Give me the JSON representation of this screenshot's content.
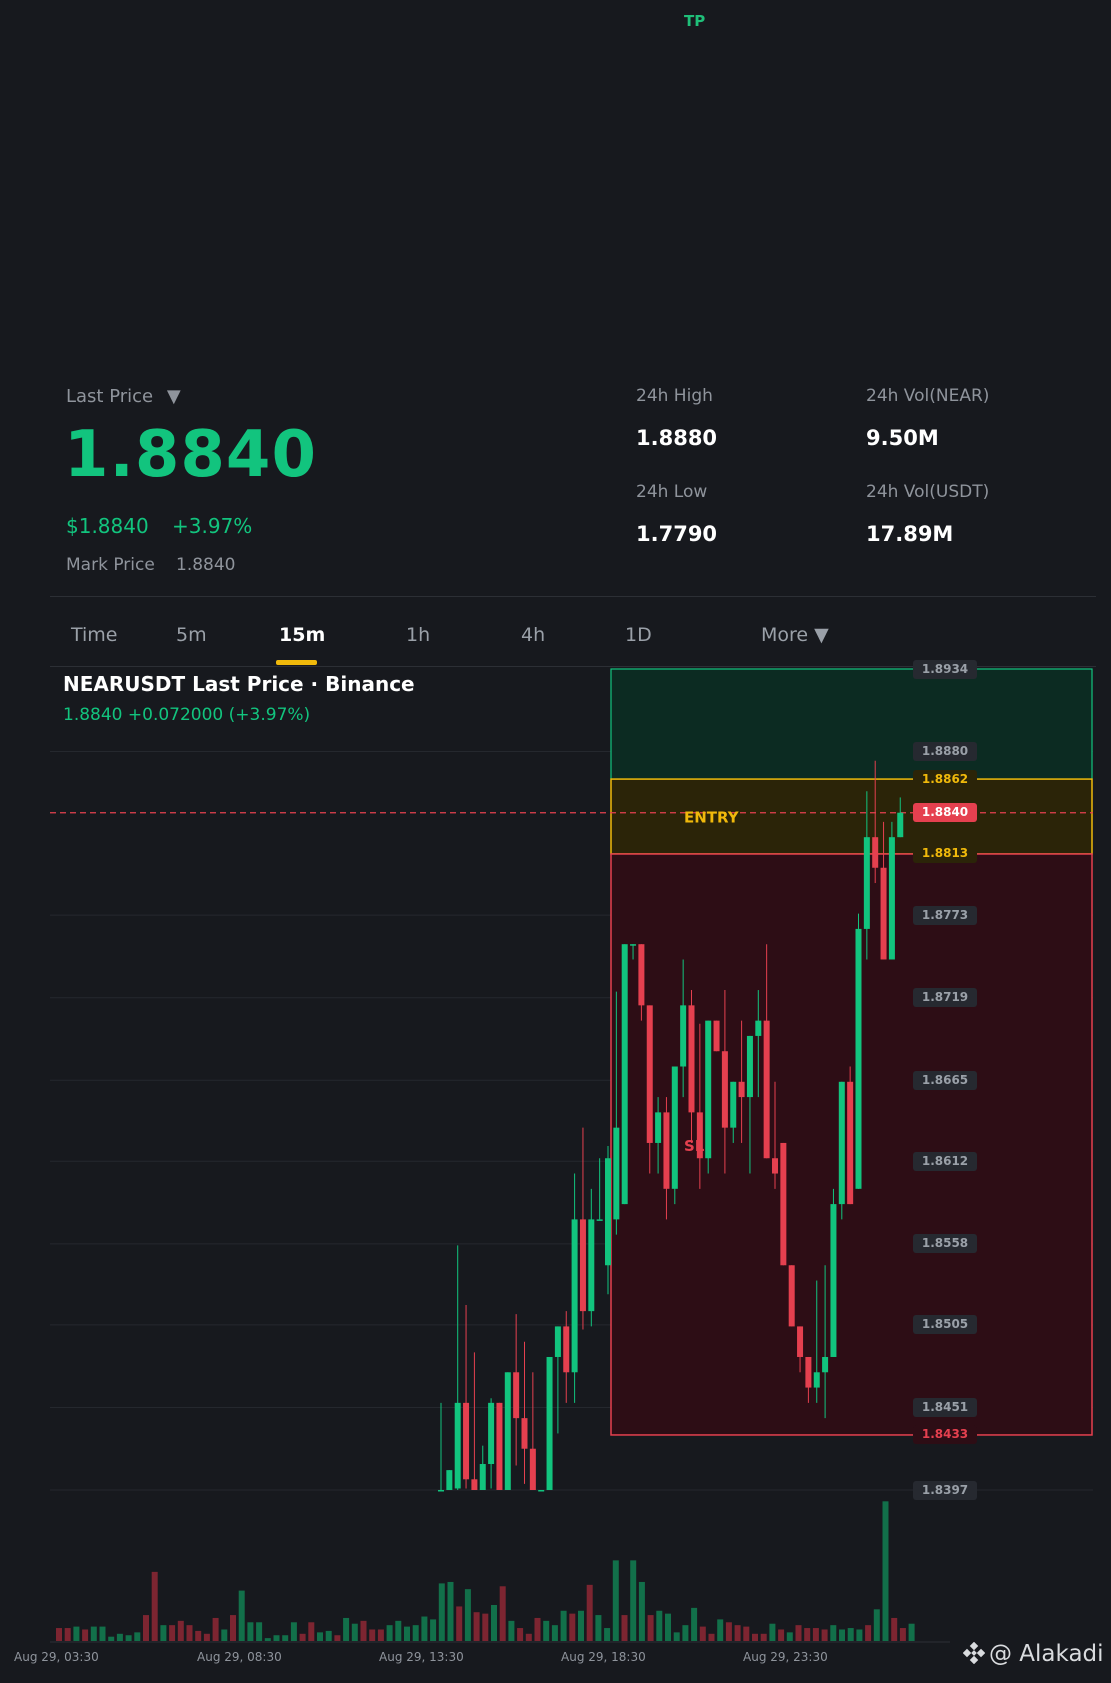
{
  "overlay": {
    "tp_label": "TP",
    "entry_label": "ENTRY",
    "sl_label": "SL"
  },
  "header": {
    "last_price_label": "Last Price",
    "last_price_caret": "▼",
    "last_price": "1.8840",
    "usd_price": "$1.8840",
    "change_pct": "+3.97%",
    "mark_price_label": "Mark Price",
    "mark_price": "1.8840"
  },
  "stats": {
    "high_label": "24h High",
    "high_value": "1.8880",
    "low_label": "24h Low",
    "low_value": "1.7790",
    "vol_base_label": "24h Vol(NEAR)",
    "vol_base_value": "9.50M",
    "vol_quote_label": "24h Vol(USDT)",
    "vol_quote_value": "17.89M"
  },
  "tabs": [
    {
      "label": "Time"
    },
    {
      "label": "5m"
    },
    {
      "label": "15m"
    },
    {
      "label": "1h"
    },
    {
      "label": "4h"
    },
    {
      "label": "1D"
    },
    {
      "label": "More ▼"
    }
  ],
  "active_tab": "15m",
  "chart": {
    "title": "NEARUSDT Last Price · Binance",
    "price_line": "1.8840  +0.072000 (+3.97%)"
  },
  "watermark": "@ Alakadi",
  "colors": {
    "up": "#12c47e",
    "down": "#e5404f",
    "entry": "#f0b90b",
    "tp_zone": "#0c2b22",
    "entry_zone": "#2b2408",
    "sl_zone": "#2d0d15"
  },
  "chart_data": {
    "type": "candlestick",
    "symbol": "NEARUSDT",
    "interval": "15m",
    "x_labels": [
      "Aug 29, 03:30",
      "Aug 29, 08:30",
      "Aug 29, 13:30",
      "Aug 29, 18:30",
      "Aug 29, 23:30"
    ],
    "y_ticks": [
      1.8934,
      1.888,
      1.8773,
      1.8719,
      1.8665,
      1.8612,
      1.8558,
      1.8505,
      1.8451,
      1.8397
    ],
    "levels": {
      "tp": 1.8934,
      "entry_high": 1.8862,
      "entry_low": 1.8813,
      "sl": 1.8433,
      "last": 1.884
    },
    "candles": [
      {
        "o": 1.8392,
        "h": 1.8454,
        "l": 1.8392,
        "c": 1.8397
      },
      {
        "o": 1.8397,
        "h": 1.8404,
        "l": 1.8387,
        "c": 1.841
      },
      {
        "o": 1.8398,
        "h": 1.8557,
        "l": 1.8393,
        "c": 1.8454
      },
      {
        "o": 1.8454,
        "h": 1.8518,
        "l": 1.8398,
        "c": 1.8404
      },
      {
        "o": 1.8404,
        "h": 1.8487,
        "l": 1.8398,
        "c": 1.8393
      },
      {
        "o": 1.8393,
        "h": 1.8426,
        "l": 1.8396,
        "c": 1.8414
      },
      {
        "o": 1.8414,
        "h": 1.8457,
        "l": 1.8398,
        "c": 1.8454
      },
      {
        "o": 1.8454,
        "h": 1.8454,
        "l": 1.8392,
        "c": 1.8393
      },
      {
        "o": 1.8393,
        "h": 1.8474,
        "l": 1.8394,
        "c": 1.8474
      },
      {
        "o": 1.8474,
        "h": 1.8512,
        "l": 1.8413,
        "c": 1.8444
      },
      {
        "o": 1.8444,
        "h": 1.8494,
        "l": 1.8401,
        "c": 1.8424
      },
      {
        "o": 1.8424,
        "h": 1.8474,
        "l": 1.8388,
        "c": 1.8393
      },
      {
        "o": 1.8393,
        "h": 1.8392,
        "l": 1.8392,
        "c": 1.8394
      },
      {
        "o": 1.8394,
        "h": 1.8484,
        "l": 1.8413,
        "c": 1.8484
      },
      {
        "o": 1.8484,
        "h": 1.8504,
        "l": 1.8434,
        "c": 1.8504
      },
      {
        "o": 1.8504,
        "h": 1.8514,
        "l": 1.8454,
        "c": 1.8474
      },
      {
        "o": 1.8474,
        "h": 1.8604,
        "l": 1.8454,
        "c": 1.8574
      },
      {
        "o": 1.8574,
        "h": 1.8634,
        "l": 1.8502,
        "c": 1.8514
      },
      {
        "o": 1.8514,
        "h": 1.8594,
        "l": 1.8504,
        "c": 1.8574
      },
      {
        "o": 1.8574,
        "h": 1.8614,
        "l": 1.8574,
        "c": 1.8574
      },
      {
        "o": 1.8544,
        "h": 1.8622,
        "l": 1.8525,
        "c": 1.8614
      },
      {
        "o": 1.8574,
        "h": 1.8723,
        "l": 1.8564,
        "c": 1.8634
      },
      {
        "o": 1.8584,
        "h": 1.8743,
        "l": 1.8584,
        "c": 1.8754
      },
      {
        "o": 1.8754,
        "h": 1.8744,
        "l": 1.8744,
        "c": 1.8754
      },
      {
        "o": 1.8754,
        "h": 1.8754,
        "l": 1.8704,
        "c": 1.8714
      },
      {
        "o": 1.8714,
        "h": 1.8704,
        "l": 1.8604,
        "c": 1.8624
      },
      {
        "o": 1.8624,
        "h": 1.8654,
        "l": 1.8604,
        "c": 1.8644
      },
      {
        "o": 1.8644,
        "h": 1.8654,
        "l": 1.8574,
        "c": 1.8594
      },
      {
        "o": 1.8594,
        "h": 1.8674,
        "l": 1.8584,
        "c": 1.8674
      },
      {
        "o": 1.8674,
        "h": 1.8744,
        "l": 1.8654,
        "c": 1.8714
      },
      {
        "o": 1.8714,
        "h": 1.8724,
        "l": 1.8624,
        "c": 1.8644
      },
      {
        "o": 1.8644,
        "h": 1.8702,
        "l": 1.8594,
        "c": 1.8614
      },
      {
        "o": 1.8614,
        "h": 1.8704,
        "l": 1.8604,
        "c": 1.8704
      },
      {
        "o": 1.8704,
        "h": 1.8704,
        "l": 1.8684,
        "c": 1.8684
      },
      {
        "o": 1.8684,
        "h": 1.8724,
        "l": 1.8604,
        "c": 1.8634
      },
      {
        "o": 1.8634,
        "h": 1.8664,
        "l": 1.8624,
        "c": 1.8664
      },
      {
        "o": 1.8664,
        "h": 1.8704,
        "l": 1.8624,
        "c": 1.8654
      },
      {
        "o": 1.8654,
        "h": 1.8694,
        "l": 1.8604,
        "c": 1.8694
      },
      {
        "o": 1.8694,
        "h": 1.8724,
        "l": 1.8654,
        "c": 1.8704
      },
      {
        "o": 1.8704,
        "h": 1.8754,
        "l": 1.8614,
        "c": 1.8614
      },
      {
        "o": 1.8614,
        "h": 1.8664,
        "l": 1.8594,
        "c": 1.8604
      },
      {
        "o": 1.8624,
        "h": 1.8624,
        "l": 1.8544,
        "c": 1.8544
      },
      {
        "o": 1.8544,
        "h": 1.8544,
        "l": 1.8504,
        "c": 1.8504
      },
      {
        "o": 1.8504,
        "h": 1.8504,
        "l": 1.8474,
        "c": 1.8484
      },
      {
        "o": 1.8484,
        "h": 1.8474,
        "l": 1.8454,
        "c": 1.8464
      },
      {
        "o": 1.8464,
        "h": 1.8534,
        "l": 1.8454,
        "c": 1.8474
      },
      {
        "o": 1.8474,
        "h": 1.8544,
        "l": 1.8444,
        "c": 1.8484
      },
      {
        "o": 1.8484,
        "h": 1.8594,
        "l": 1.8484,
        "c": 1.8584
      },
      {
        "o": 1.8584,
        "h": 1.8654,
        "l": 1.8574,
        "c": 1.8664
      },
      {
        "o": 1.8664,
        "h": 1.8674,
        "l": 1.8584,
        "c": 1.8584
      },
      {
        "o": 1.8594,
        "h": 1.8774,
        "l": 1.8594,
        "c": 1.8764
      },
      {
        "o": 1.8764,
        "h": 1.8854,
        "l": 1.8744,
        "c": 1.8824
      },
      {
        "o": 1.8824,
        "h": 1.8874,
        "l": 1.8794,
        "c": 1.8804
      },
      {
        "o": 1.8804,
        "h": 1.8834,
        "l": 1.8744,
        "c": 1.8744
      },
      {
        "o": 1.8744,
        "h": 1.8834,
        "l": 1.8744,
        "c": 1.8824
      },
      {
        "o": 1.8824,
        "h": 1.885,
        "l": 1.8824,
        "c": 1.884
      }
    ],
    "volume": [
      {
        "v": 0.09,
        "up": false
      },
      {
        "v": 0.09,
        "up": false
      },
      {
        "v": 0.1,
        "up": true
      },
      {
        "v": 0.08,
        "up": false
      },
      {
        "v": 0.1,
        "up": true
      },
      {
        "v": 0.1,
        "up": true
      },
      {
        "v": 0.03,
        "up": true
      },
      {
        "v": 0.05,
        "up": true
      },
      {
        "v": 0.04,
        "up": true
      },
      {
        "v": 0.06,
        "up": true
      },
      {
        "v": 0.18,
        "up": false
      },
      {
        "v": 0.48,
        "up": false
      },
      {
        "v": 0.11,
        "up": true
      },
      {
        "v": 0.11,
        "up": false
      },
      {
        "v": 0.14,
        "up": false
      },
      {
        "v": 0.11,
        "up": false
      },
      {
        "v": 0.07,
        "up": false
      },
      {
        "v": 0.05,
        "up": false
      },
      {
        "v": 0.16,
        "up": false
      },
      {
        "v": 0.08,
        "up": true
      },
      {
        "v": 0.18,
        "up": false
      },
      {
        "v": 0.35,
        "up": true
      },
      {
        "v": 0.13,
        "up": true
      },
      {
        "v": 0.13,
        "up": true
      },
      {
        "v": 0.02,
        "up": true
      },
      {
        "v": 0.04,
        "up": true
      },
      {
        "v": 0.04,
        "up": true
      },
      {
        "v": 0.13,
        "up": true
      },
      {
        "v": 0.05,
        "up": false
      },
      {
        "v": 0.13,
        "up": false
      },
      {
        "v": 0.06,
        "up": true
      },
      {
        "v": 0.07,
        "up": true
      },
      {
        "v": 0.04,
        "up": false
      },
      {
        "v": 0.16,
        "up": true
      },
      {
        "v": 0.12,
        "up": true
      },
      {
        "v": 0.14,
        "up": false
      },
      {
        "v": 0.08,
        "up": false
      },
      {
        "v": 0.08,
        "up": false
      },
      {
        "v": 0.11,
        "up": true
      },
      {
        "v": 0.14,
        "up": true
      },
      {
        "v": 0.1,
        "up": true
      },
      {
        "v": 0.11,
        "up": true
      },
      {
        "v": 0.17,
        "up": true
      },
      {
        "v": 0.15,
        "up": true
      },
      {
        "v": 0.4,
        "up": true
      },
      {
        "v": 0.41,
        "up": true
      },
      {
        "v": 0.24,
        "up": false
      },
      {
        "v": 0.36,
        "up": true
      },
      {
        "v": 0.2,
        "up": false
      },
      {
        "v": 0.19,
        "up": false
      },
      {
        "v": 0.25,
        "up": true
      },
      {
        "v": 0.38,
        "up": false
      },
      {
        "v": 0.14,
        "up": true
      },
      {
        "v": 0.09,
        "up": false
      },
      {
        "v": 0.05,
        "up": false
      },
      {
        "v": 0.16,
        "up": false
      },
      {
        "v": 0.14,
        "up": true
      },
      {
        "v": 0.11,
        "up": true
      },
      {
        "v": 0.21,
        "up": true
      },
      {
        "v": 0.19,
        "up": false
      },
      {
        "v": 0.21,
        "up": true
      },
      {
        "v": 0.39,
        "up": false
      },
      {
        "v": 0.18,
        "up": true
      },
      {
        "v": 0.09,
        "up": true
      },
      {
        "v": 0.56,
        "up": true
      },
      {
        "v": 0.18,
        "up": false
      },
      {
        "v": 0.56,
        "up": true
      },
      {
        "v": 0.41,
        "up": true
      },
      {
        "v": 0.18,
        "up": false
      },
      {
        "v": 0.21,
        "up": true
      },
      {
        "v": 0.19,
        "up": true
      },
      {
        "v": 0.06,
        "up": true
      },
      {
        "v": 0.11,
        "up": true
      },
      {
        "v": 0.23,
        "up": true
      },
      {
        "v": 0.1,
        "up": false
      },
      {
        "v": 0.05,
        "up": false
      },
      {
        "v": 0.15,
        "up": true
      },
      {
        "v": 0.13,
        "up": false
      },
      {
        "v": 0.11,
        "up": false
      },
      {
        "v": 0.1,
        "up": false
      },
      {
        "v": 0.05,
        "up": false
      },
      {
        "v": 0.05,
        "up": false
      },
      {
        "v": 0.12,
        "up": true
      },
      {
        "v": 0.08,
        "up": false
      },
      {
        "v": 0.06,
        "up": true
      },
      {
        "v": 0.11,
        "up": false
      },
      {
        "v": 0.09,
        "up": false
      },
      {
        "v": 0.09,
        "up": false
      },
      {
        "v": 0.08,
        "up": false
      },
      {
        "v": 0.11,
        "up": true
      },
      {
        "v": 0.08,
        "up": true
      },
      {
        "v": 0.09,
        "up": true
      },
      {
        "v": 0.08,
        "up": true
      },
      {
        "v": 0.11,
        "up": false
      },
      {
        "v": 0.22,
        "up": true
      },
      {
        "v": 0.97,
        "up": true
      },
      {
        "v": 0.16,
        "up": false
      },
      {
        "v": 0.09,
        "up": false
      },
      {
        "v": 0.12,
        "up": true
      }
    ]
  }
}
